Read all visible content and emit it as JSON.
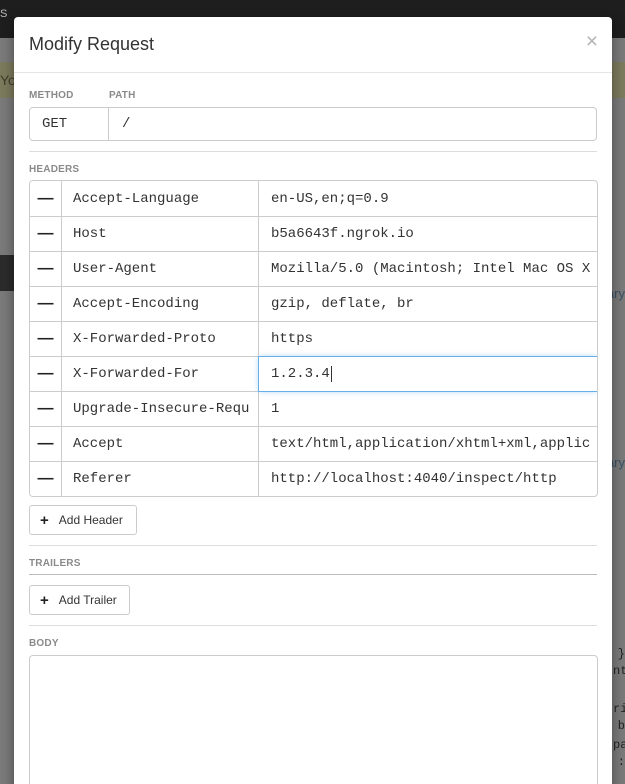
{
  "background": {
    "topbar_text": "S",
    "alert_text": "Yo",
    "side_links": [
      "ary",
      "ary"
    ],
    "code_chars": [
      "}",
      "nt",
      "",
      "ri",
      "b",
      "pa",
      ":"
    ]
  },
  "modal": {
    "title": "Modify Request",
    "close_symbol": "×",
    "method_label": "METHOD",
    "path_label": "PATH",
    "method_value": "GET",
    "path_value": "/",
    "headers_label": "HEADERS",
    "headers": [
      {
        "key": "Accept-Language",
        "value": "en-US,en;q=0.9"
      },
      {
        "key": "Host",
        "value": "b5a6643f.ngrok.io"
      },
      {
        "key": "User-Agent",
        "value": "Mozilla/5.0 (Macintosh; Intel Mac OS X"
      },
      {
        "key": "Accept-Encoding",
        "value": "gzip, deflate, br"
      },
      {
        "key": "X-Forwarded-Proto",
        "value": "https"
      },
      {
        "key": "X-Forwarded-For",
        "value": "1.2.3.4"
      },
      {
        "key": "Upgrade-Insecure-Requ",
        "value": "1"
      },
      {
        "key": "Accept",
        "value": "text/html,application/xhtml+xml,applic"
      },
      {
        "key": "Referer",
        "value": "http://localhost:4040/inspect/http"
      }
    ],
    "remove_symbol": "—",
    "add_header_label": "Add Header",
    "trailers_label": "TRAILERS",
    "add_trailer_label": "Add Trailer",
    "body_label": "BODY",
    "body_value": "",
    "plus_symbol": "+"
  }
}
